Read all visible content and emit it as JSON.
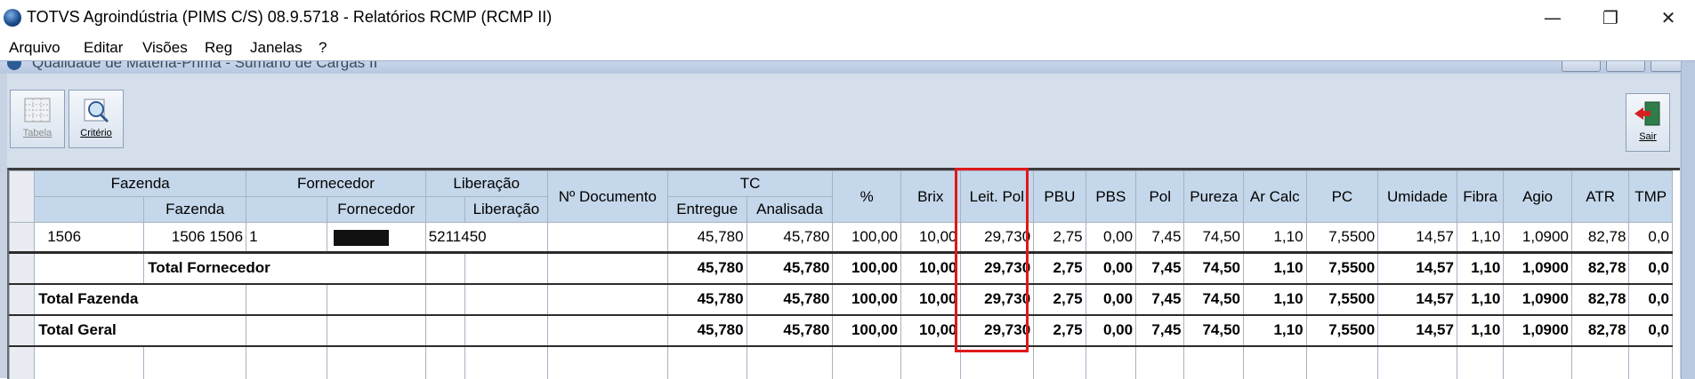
{
  "window": {
    "title": "TOTVS Agroindústria (PIMS C/S) 08.9.5718 - Relatórios RCMP (RCMP II)",
    "controls": {
      "minimize": "—",
      "restore": "❐",
      "close": "✕"
    }
  },
  "menu": [
    "Arquivo",
    "Editar",
    "Visões",
    "Reg",
    "Janelas",
    "?"
  ],
  "child_window": {
    "title": "Qualidade de Matéria-Prima - Sumário de Cargas II"
  },
  "toolbar": {
    "tabela_label": "Tabela",
    "criterio_label": "Critério",
    "sair_label": "Sair"
  },
  "grid": {
    "group_headers": {
      "fazenda": "Fazenda",
      "fornecedor": "Fornecedor",
      "liberacao": "Liberação",
      "documento": "Nº Documento",
      "tc": "TC",
      "pct": "%",
      "brix": "Brix",
      "leit_pol": "Leit. Pol",
      "pbu": "PBU",
      "pbs": "PBS",
      "pol": "Pol",
      "pureza": "Pureza",
      "ar_calc": "Ar Calc",
      "pc": "PC",
      "umidade": "Umidade",
      "fibra": "Fibra",
      "agio": "Agio",
      "atr": "ATR",
      "tmp": "TMP"
    },
    "sub_headers": {
      "fazenda": "Fazenda",
      "fornecedor": "Fornecedor",
      "liberacao": "Liberação",
      "entregue": "Entregue",
      "analisada": "Analisada"
    },
    "row": {
      "fazenda_code": "1506",
      "fazenda": "1506 1506",
      "fornecedor_code": "1",
      "liberacao": "5211450",
      "tc_entregue": "45,780",
      "tc_analisada": "45,780",
      "pct": "100,00",
      "brix": "10,00",
      "leit_pol": "29,730",
      "pbu": "2,75",
      "pbs": "0,00",
      "pol": "7,45",
      "pureza": "74,50",
      "ar_calc": "1,10",
      "pc": "7,5500",
      "umidade": "14,57",
      "fibra": "1,10",
      "agio": "1,0900",
      "atr": "82,78",
      "tmp": "0,0"
    },
    "totals": [
      {
        "label": "Total Fornecedor",
        "tc_entregue": "45,780",
        "tc_analisada": "45,780",
        "pct": "100,00",
        "brix": "10,00",
        "leit_pol": "29,730",
        "pbu": "2,75",
        "pbs": "0,00",
        "pol": "7,45",
        "pureza": "74,50",
        "ar_calc": "1,10",
        "pc": "7,5500",
        "umidade": "14,57",
        "fibra": "1,10",
        "agio": "1,0900",
        "atr": "82,78",
        "tmp": "0,0"
      },
      {
        "label": "Total Fazenda",
        "tc_entregue": "45,780",
        "tc_analisada": "45,780",
        "pct": "100,00",
        "brix": "10,00",
        "leit_pol": "29,730",
        "pbu": "2,75",
        "pbs": "0,00",
        "pol": "7,45",
        "pureza": "74,50",
        "ar_calc": "1,10",
        "pc": "7,5500",
        "umidade": "14,57",
        "fibra": "1,10",
        "agio": "1,0900",
        "atr": "82,78",
        "tmp": "0,0"
      },
      {
        "label": "Total Geral",
        "tc_entregue": "45,780",
        "tc_analisada": "45,780",
        "pct": "100,00",
        "brix": "10,00",
        "leit_pol": "29,730",
        "pbu": "2,75",
        "pbs": "0,00",
        "pol": "7,45",
        "pureza": "74,50",
        "ar_calc": "1,10",
        "pc": "7,5500",
        "umidade": "14,57",
        "fibra": "1,10",
        "agio": "1,0900",
        "atr": "82,78",
        "tmp": "0,0"
      }
    ]
  },
  "highlight": {
    "color": "#e01818",
    "column": "Leit. Pol"
  }
}
